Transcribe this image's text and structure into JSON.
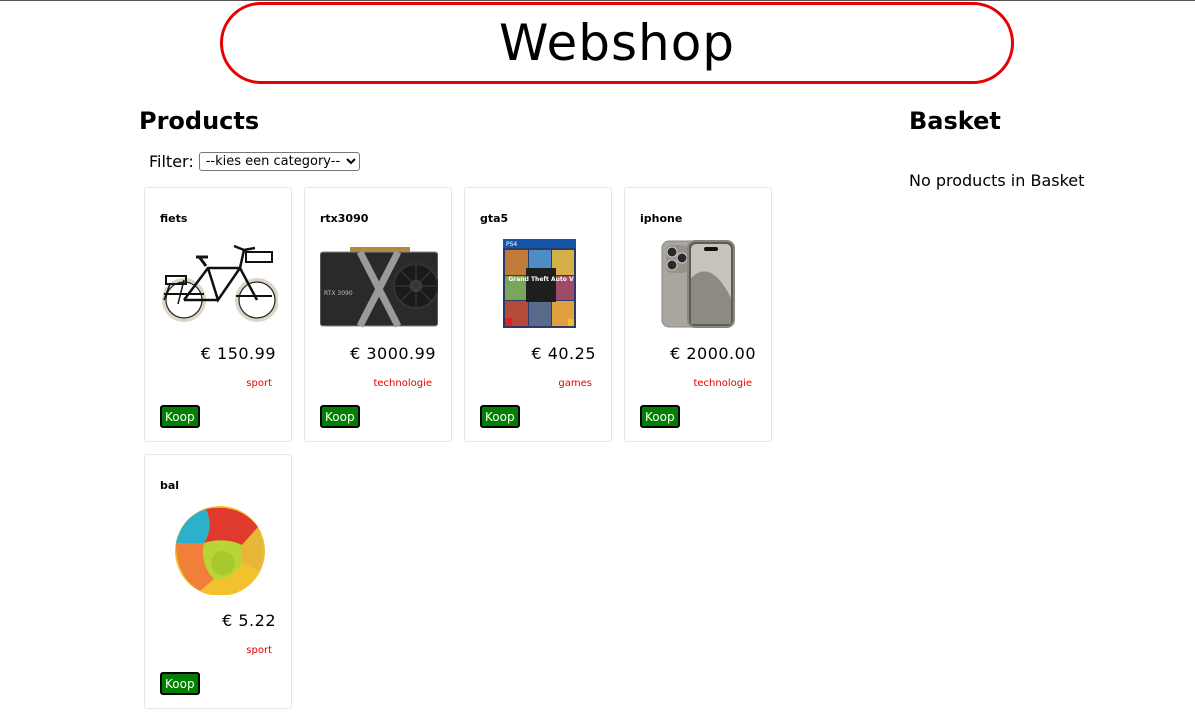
{
  "header": {
    "title": "Webshop"
  },
  "products": {
    "title": "Products",
    "filter": {
      "label": "Filter:",
      "selected": "--kies een category--"
    },
    "buy_label": "Koop",
    "items": [
      {
        "name": "fiets",
        "price": "€ 150.99",
        "category": "sport",
        "image": "bicycle"
      },
      {
        "name": "rtx3090",
        "price": "€ 3000.99",
        "category": "technologie",
        "image": "graphics-card"
      },
      {
        "name": "gta5",
        "price": "€ 40.25",
        "category": "games",
        "image": "game-cover"
      },
      {
        "name": "iphone",
        "price": "€ 2000.00",
        "category": "technologie",
        "image": "phone"
      },
      {
        "name": "bal",
        "price": "€ 5.22",
        "category": "sport",
        "image": "ball"
      }
    ]
  },
  "basket": {
    "title": "Basket",
    "empty_text": "No products in Basket"
  },
  "images": {
    "gta_cover_text": "Grand Theft Auto V",
    "ps4_badge": "PS4",
    "rtx_label": "RTX 3090"
  },
  "colors": {
    "accent": "#e60000",
    "buy_button": "#008000"
  }
}
